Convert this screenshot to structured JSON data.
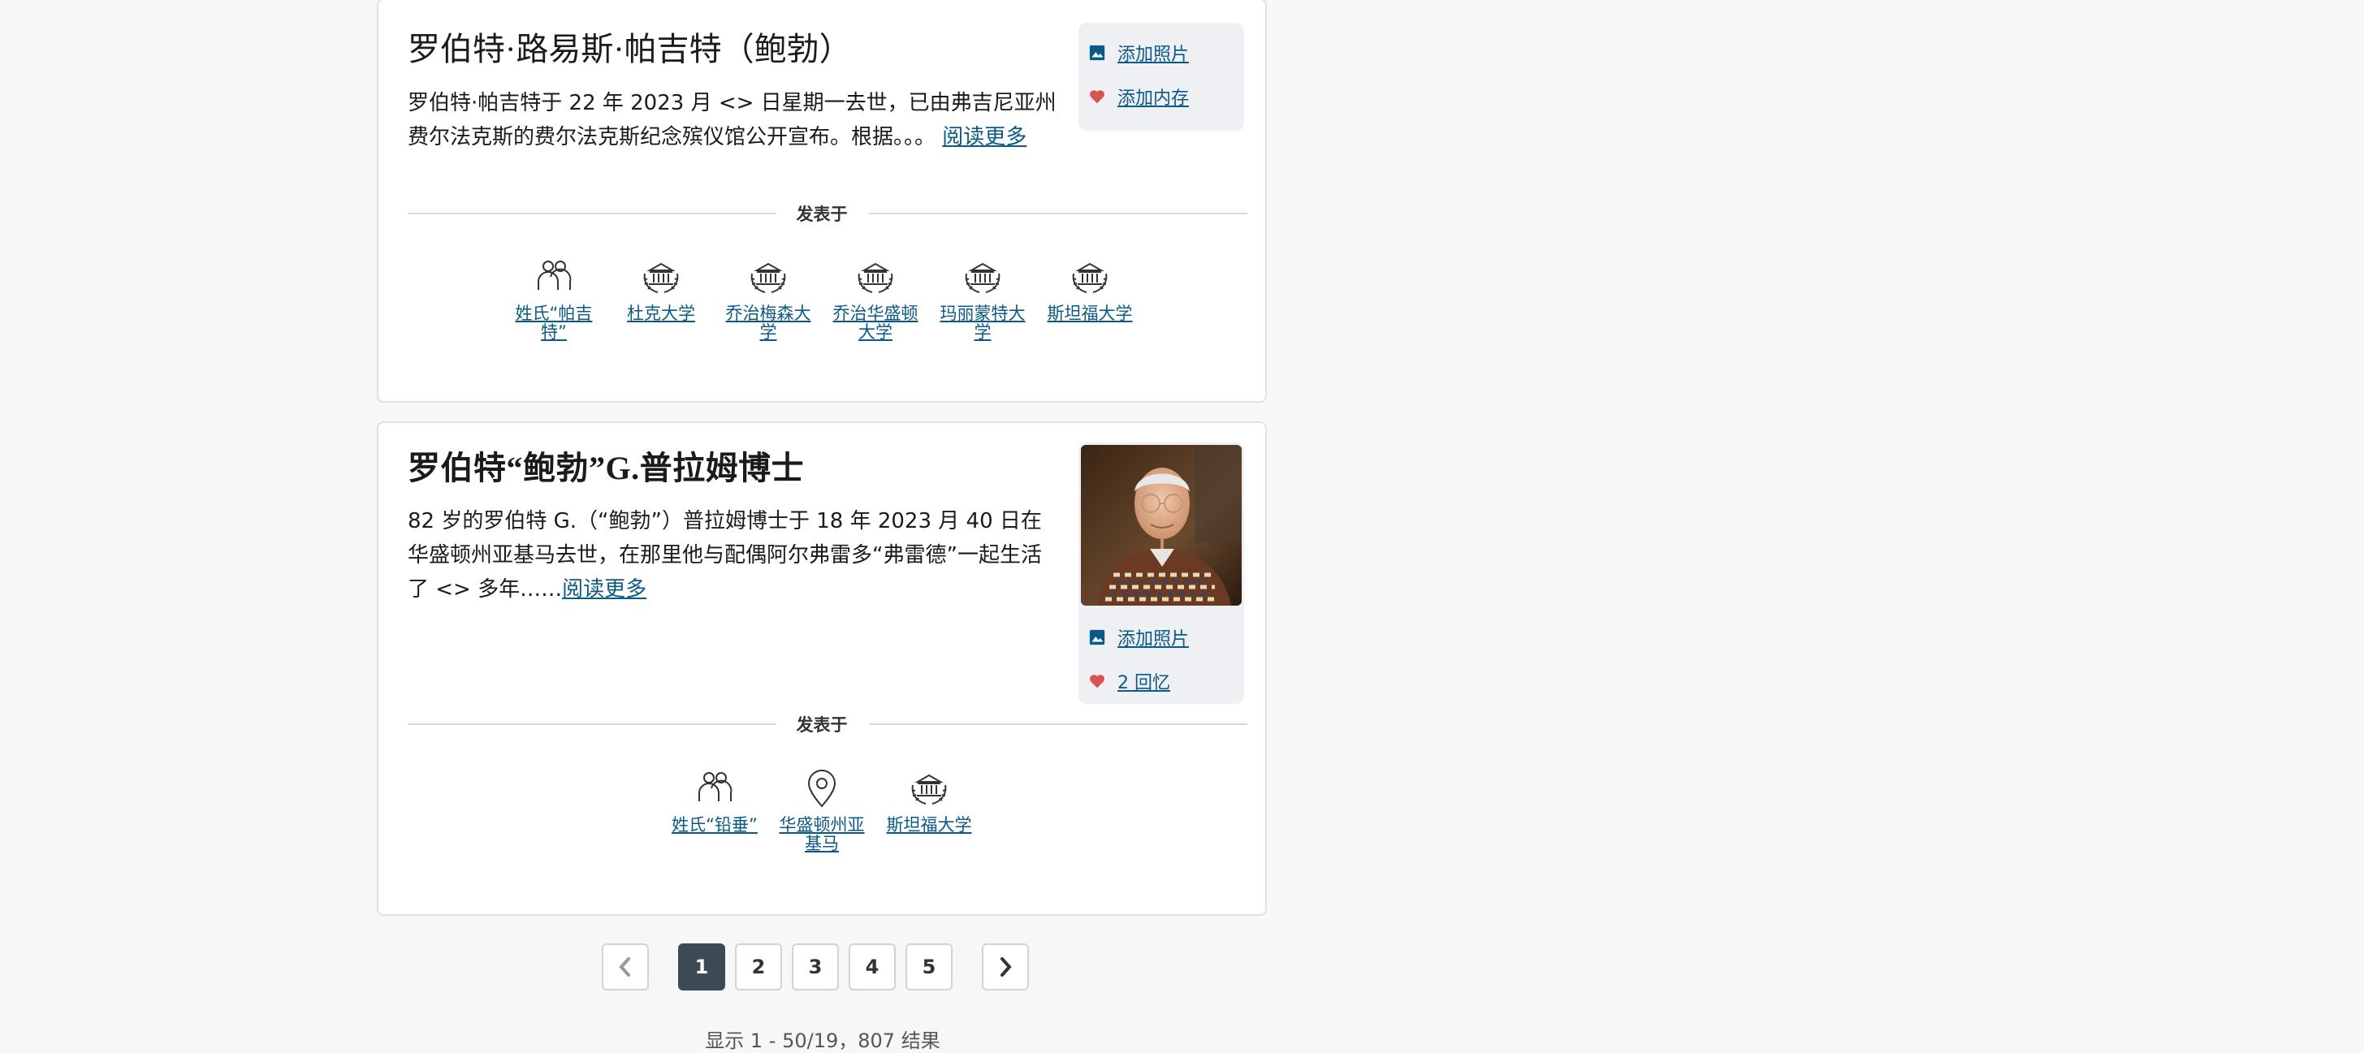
{
  "obituaries": [
    {
      "title": "罗伯特·路易斯·帕吉特（鲍勃）",
      "excerpt": "罗伯特·帕吉特于 22 年 2023 月 <> 日星期一去世，已由弗吉尼亚州费尔法克斯的费尔法克斯纪念殡仪馆公开宣布。根据。。。",
      "read_more": "阅读更多",
      "add_photo": "添加照片",
      "memories": "添加内存",
      "published_in_label": "发表于",
      "published_in": [
        {
          "label": "姓氏“帕吉特”",
          "icon": "people-icon"
        },
        {
          "label": "杜克大学",
          "icon": "university-icon"
        },
        {
          "label": "乔治梅森大学",
          "icon": "university-icon"
        },
        {
          "label": "乔治华盛顿大学",
          "icon": "university-icon"
        },
        {
          "label": "玛丽蒙特大学",
          "icon": "university-icon"
        },
        {
          "label": "斯坦福大学",
          "icon": "university-icon"
        }
      ]
    },
    {
      "title": "罗伯特“鲍勃”G.普拉姆博士",
      "excerpt": "82 岁的罗伯特 G.（“鲍勃”）普拉姆博士于 18 年 2023 月 40 日在华盛顿州亚基马去世，在那里他与配偶阿尔弗雷多“弗雷德”一起生活了 <> 多年……",
      "read_more": "阅读更多",
      "add_photo": "添加照片",
      "memories": "2 回忆",
      "published_in_label": "发表于",
      "published_in": [
        {
          "label": "姓氏“铅垂”",
          "icon": "people-icon"
        },
        {
          "label": "华盛顿州亚基马",
          "icon": "location-pin-icon"
        },
        {
          "label": "斯坦福大学",
          "icon": "university-icon"
        }
      ]
    }
  ],
  "pagination": {
    "pages": [
      "1",
      "2",
      "3",
      "4",
      "5"
    ],
    "current": "1",
    "results_text": "显示 1 - 50/19，807 结果"
  },
  "colors": {
    "link": "#0b5a85",
    "heart": "#d9534f",
    "active_page": "#3d4a55"
  }
}
